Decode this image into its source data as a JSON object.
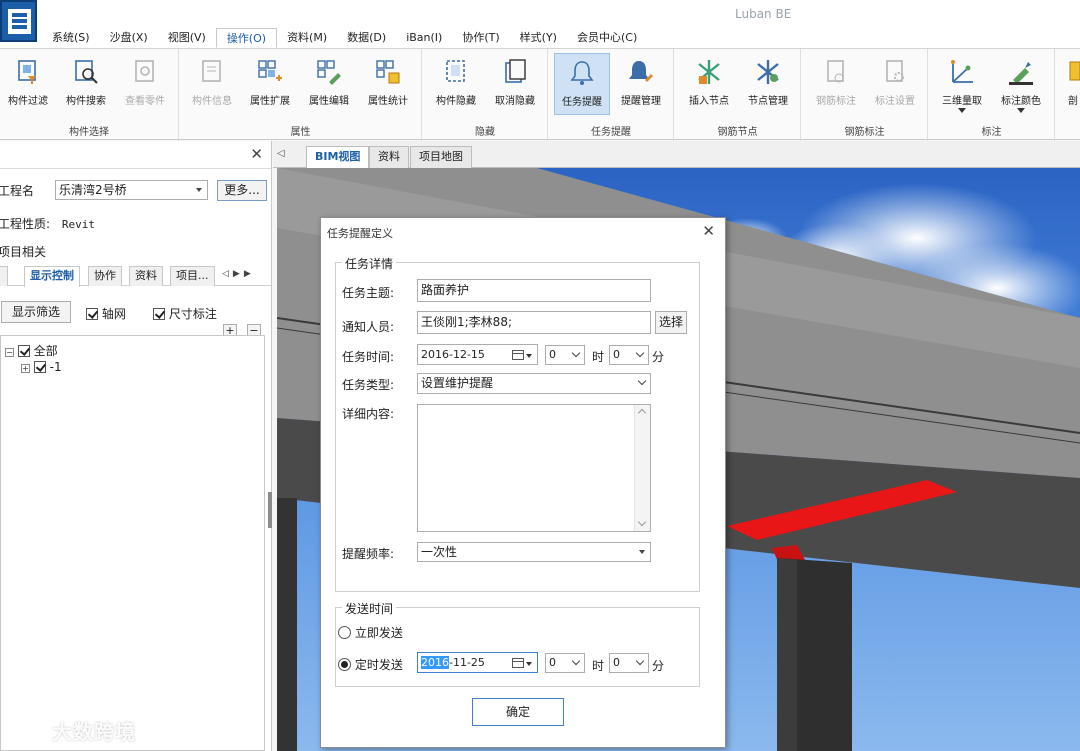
{
  "app": {
    "title": "Luban BE"
  },
  "menu": [
    {
      "label": "系统(S)"
    },
    {
      "label": "沙盘(X)"
    },
    {
      "label": "视图(V)"
    },
    {
      "label": "操作(O)"
    },
    {
      "label": "资料(M)"
    },
    {
      "label": "数据(D)"
    },
    {
      "label": "iBan(I)"
    },
    {
      "label": "协作(T)"
    },
    {
      "label": "样式(Y)"
    },
    {
      "label": "会员中心(C)"
    }
  ],
  "ribbon": {
    "groups": {
      "component_select": "构件选择",
      "attributes": "属性",
      "hide": "隐藏",
      "task_reminder": "任务提醒",
      "rebar_node": "钢筋节点",
      "rebar_label": "钢筋标注",
      "annotation": "标注"
    },
    "buttons": {
      "component_filter": "构件过滤",
      "component_search": "构件搜索",
      "view_parts": "查看零件",
      "component_info": "构件信息",
      "attr_extend": "属性扩展",
      "attr_edit": "属性编辑",
      "attr_stats": "属性统计",
      "component_hide": "构件隐藏",
      "cancel_hide": "取消隐藏",
      "task_reminder": "任务提醒",
      "reminder_manage": "提醒管理",
      "insert_node": "插入节点",
      "node_manage": "节点管理",
      "rebar_label": "钢筋标注",
      "label_settings": "标注设置",
      "measure_3d": "三维量取",
      "label_color": "标注颜色",
      "more_cut": "剖"
    }
  },
  "left_panel": {
    "project_label": "工程名",
    "project_value": "乐清湾2号桥",
    "more_button": "更多...",
    "project_type_label": "工程性质:",
    "project_type_value": "Revit",
    "project_related": "项目相关",
    "tabs": [
      "显示控制",
      "协作",
      "资料",
      "项目..."
    ],
    "filter_button": "显示筛选",
    "axis_label": "轴网",
    "dimension_label": "尺寸标注",
    "plus": "+",
    "minus": "−",
    "tree": {
      "root": "全部",
      "child": "-1"
    }
  },
  "view_tabs": [
    "BIM视图",
    "资料",
    "项目地图"
  ],
  "dialog": {
    "title": "任务提醒定义",
    "details_legend": "任务详情",
    "subject_label": "任务主题:",
    "subject_value": "路面养护",
    "notify_label": "通知人员:",
    "notify_value": "王倓刚1;李林88;",
    "select_button": "选择",
    "time_label": "任务时间:",
    "time_date": "2016-12-15",
    "time_hour": "0",
    "hour_unit": "时",
    "time_minute": "0",
    "minute_unit": "分",
    "type_label": "任务类型:",
    "type_value": "设置维护提醒",
    "detail_label": "详细内容:",
    "frequency_label": "提醒频率:",
    "frequency_value": "一次性",
    "send_legend": "发送时间",
    "send_now": "立即发送",
    "send_scheduled": "定时发送",
    "send_date_year": "2016",
    "send_date_rest": "-11-25",
    "send_hour": "0",
    "send_minute": "0",
    "confirm_button": "确定"
  },
  "watermark": "大数跨境"
}
